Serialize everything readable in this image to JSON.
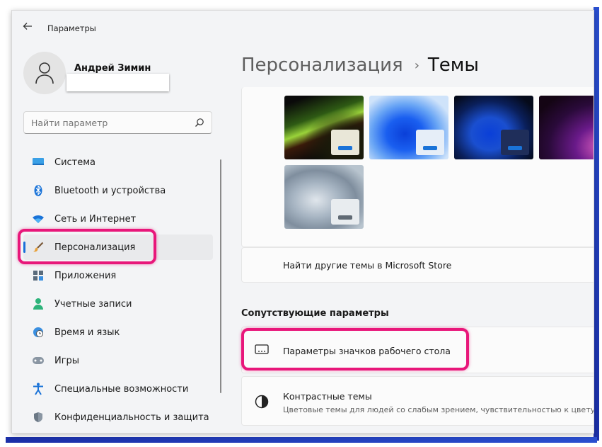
{
  "app": {
    "title": "Параметры",
    "back_icon": "arrow-left-icon"
  },
  "user": {
    "name": "Андрей Зимин"
  },
  "search": {
    "placeholder": "Найти параметр",
    "icon": "search-icon"
  },
  "sidebar": {
    "items": [
      {
        "label": "Система",
        "icon": "monitor-icon",
        "active": false
      },
      {
        "label": "Bluetooth и устройства",
        "icon": "bluetooth-icon",
        "active": false
      },
      {
        "label": "Сеть и Интернет",
        "icon": "wifi-icon",
        "active": false
      },
      {
        "label": "Персонализация",
        "icon": "brush-icon",
        "active": true
      },
      {
        "label": "Приложения",
        "icon": "apps-icon",
        "active": false
      },
      {
        "label": "Учетные записи",
        "icon": "person-icon",
        "active": false
      },
      {
        "label": "Время и язык",
        "icon": "globe-clock-icon",
        "active": false
      },
      {
        "label": "Игры",
        "icon": "gamepad-icon",
        "active": false
      },
      {
        "label": "Специальные возможности",
        "icon": "accessibility-icon",
        "active": false
      },
      {
        "label": "Конфиденциальность и защита",
        "icon": "shield-icon",
        "active": false
      }
    ]
  },
  "main": {
    "breadcrumb": {
      "parent": "Персонализация",
      "current": "Темы"
    },
    "themes": [
      {
        "name": "glow-green-theme"
      },
      {
        "name": "bloom-light-theme"
      },
      {
        "name": "bloom-dark-theme"
      },
      {
        "name": "glow-purple-theme"
      },
      {
        "name": "captured-motion-theme"
      }
    ],
    "store_link": "Найти другие темы в Microsoft Store",
    "related_section": "Сопутствующие параметры",
    "related": [
      {
        "title": "Параметры значков рабочего стола",
        "subtitle": "",
        "icon": "desktop-icon"
      },
      {
        "title": "Контрастные темы",
        "subtitle": "Цветовые темы для людей со слабым зрением, чувствительностью к цвету",
        "icon": "contrast-icon"
      }
    ]
  },
  "colors": {
    "accent": "#1a6fd8",
    "highlight": "#e8177a",
    "frame_blue": "#2a4fd0"
  }
}
